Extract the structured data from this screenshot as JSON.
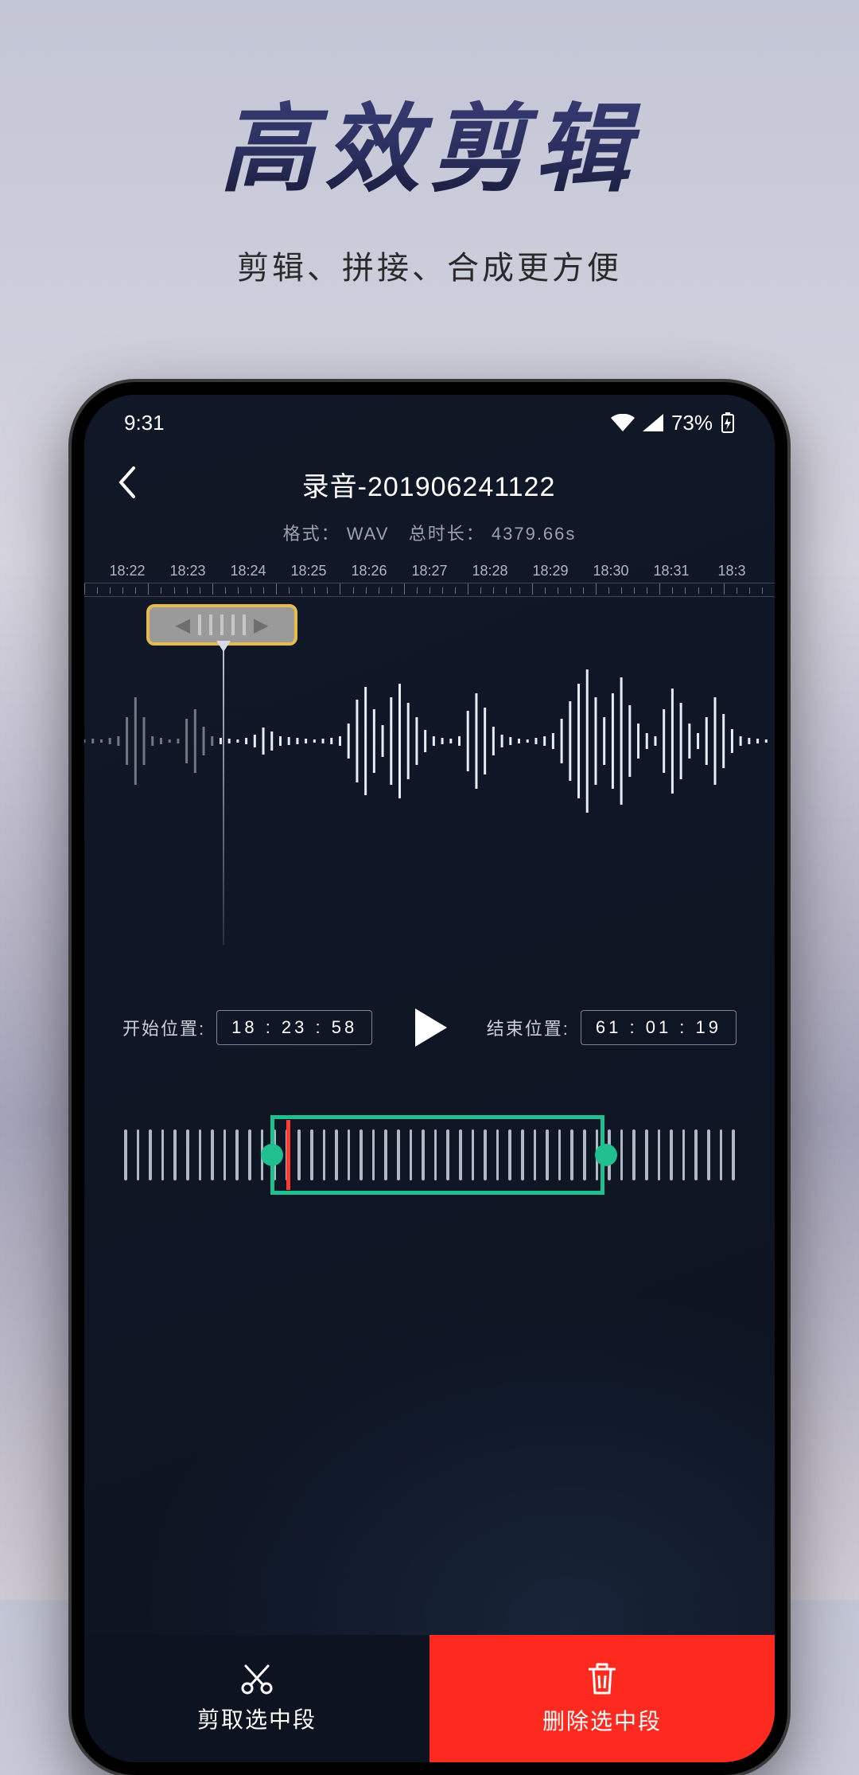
{
  "promo": {
    "title": "高效剪辑",
    "subtitle": "剪辑、拼接、合成更方便"
  },
  "status": {
    "time": "9:31",
    "battery_pct": "73%"
  },
  "header": {
    "title": "录音-201906241122",
    "format_label": "格式：",
    "format_value": "WAV",
    "duration_label": "总时长：",
    "duration_value": "4379.66s"
  },
  "timeline": {
    "ticks": [
      "18:22",
      "18:23",
      "18:24",
      "18:25",
      "18:26",
      "18:27",
      "18:28",
      "18:29",
      "18:30",
      "18:31",
      "18:3"
    ]
  },
  "controls": {
    "start_label": "开始位置:",
    "start_value": "18 : 23 : 58",
    "end_label": "结束位置:",
    "end_value": "61 : 01 : 19"
  },
  "actions": {
    "cut_label": "剪取选中段",
    "delete_label": "删除选中段"
  }
}
